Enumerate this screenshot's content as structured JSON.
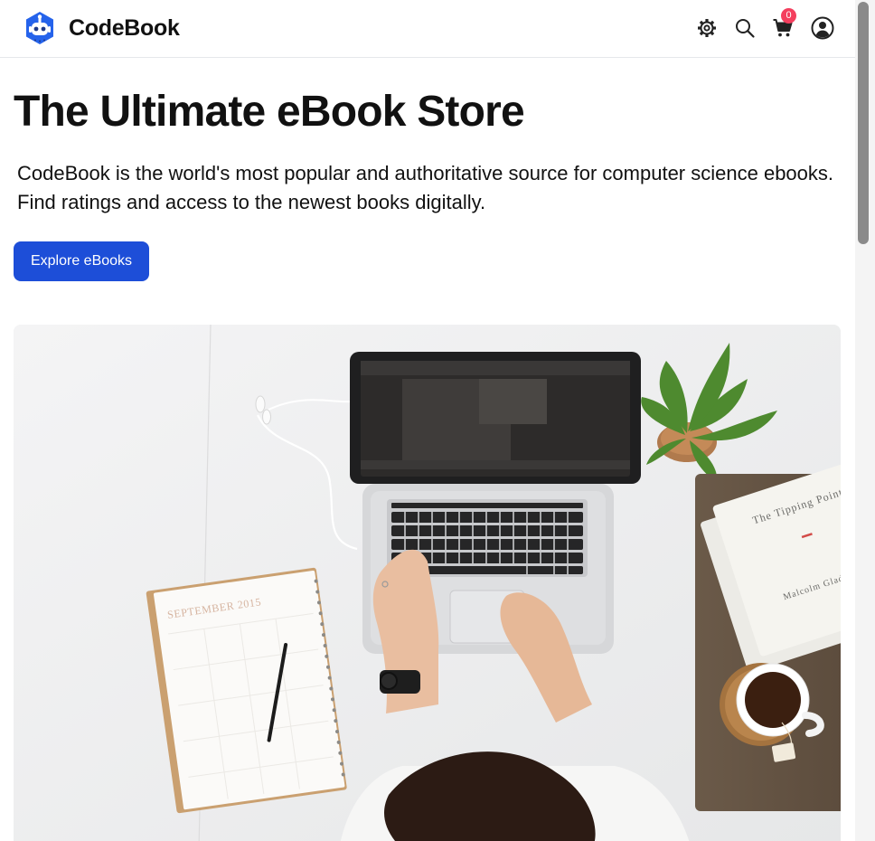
{
  "brand": {
    "name": "CodeBook",
    "logo_icon": "robot-head-logo"
  },
  "nav": {
    "settings_icon": "gear-icon",
    "search_icon": "search-icon",
    "cart_icon": "cart-icon",
    "cart_count": "0",
    "account_icon": "user-circle-icon"
  },
  "hero": {
    "title": "The Ultimate eBook Store",
    "description": "CodeBook is the world's most popular and authoritative source for computer science ebooks. Find ratings and access to the newest books digitally.",
    "cta_label": "Explore eBooks",
    "image_alt": "workspace-photo"
  },
  "notebook": {
    "month": "SEPTEMBER 2015"
  },
  "book": {
    "title": "The Tipping Point",
    "author": "Malcolm Gladwell"
  },
  "colors": {
    "accent": "#1d4ed8",
    "badge": "#f43f5e",
    "logo": "#2563eb"
  }
}
